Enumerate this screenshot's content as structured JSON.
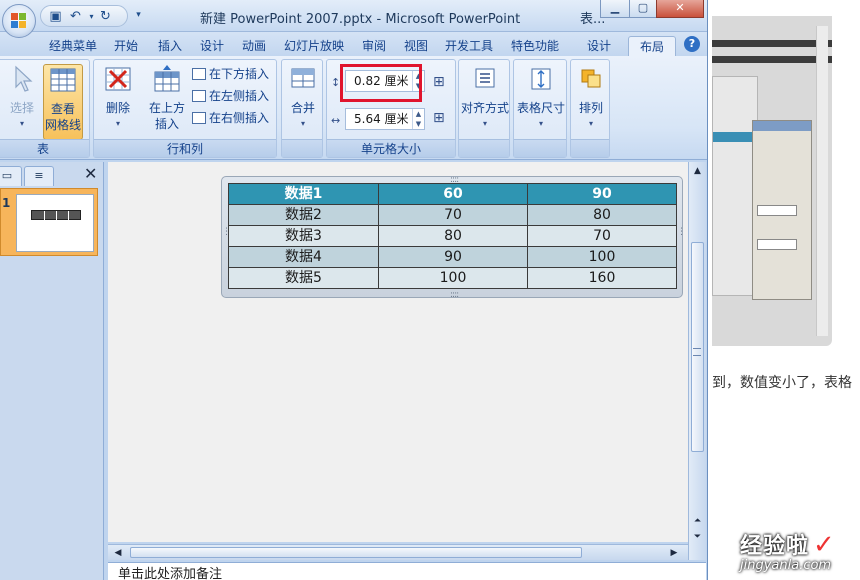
{
  "window": {
    "title": "新建 PowerPoint 2007.pptx - Microsoft PowerPoint",
    "title_extra": "表..."
  },
  "quick_access": {
    "save_icon": "save-icon",
    "undo_icon": "undo-icon",
    "redo_icon": "redo-icon",
    "customize_icon": "chevron-down-icon"
  },
  "tabs": [
    {
      "label": "经典菜单"
    },
    {
      "label": "开始"
    },
    {
      "label": "插入"
    },
    {
      "label": "设计"
    },
    {
      "label": "动画"
    },
    {
      "label": "幻灯片放映"
    },
    {
      "label": "审阅"
    },
    {
      "label": "视图"
    },
    {
      "label": "开发工具"
    },
    {
      "label": "特色功能"
    },
    {
      "label": "设计"
    },
    {
      "label": "布局"
    }
  ],
  "active_tab": "布局",
  "ribbon": {
    "table_group": {
      "label": "表",
      "select_label": "选择",
      "view_gridlines_label": "查看\n网格线"
    },
    "rows_cols_group": {
      "label": "行和列",
      "delete_label": "删除",
      "insert_above_label": "在上方\n插入",
      "insert_below_label": "在下方插入",
      "insert_left_label": "在左侧插入",
      "insert_right_label": "在右侧插入"
    },
    "merge_group": {
      "merge_label": "合并"
    },
    "cell_size_group": {
      "label": "单元格大小",
      "height_value": "0.82 厘米",
      "width_value": "5.64 厘米"
    },
    "alignment_label": "对齐方式",
    "table_size_label": "表格尺寸",
    "arrange_label": "排列"
  },
  "table": {
    "rows": [
      [
        "数据1",
        "60",
        "90"
      ],
      [
        "数据2",
        "70",
        "80"
      ],
      [
        "数据3",
        "80",
        "70"
      ],
      [
        "数据4",
        "90",
        "100"
      ],
      [
        "数据5",
        "100",
        "160"
      ]
    ]
  },
  "notes_placeholder": "单击此处添加备注",
  "web_page": {
    "text": "到，数值变小了，表格",
    "watermark": "经验啦",
    "watermark_sub": "jingyanla.com"
  },
  "colors": {
    "header_fill": "#2f95b2",
    "row_fill": "#bfd3dc",
    "row_alt_fill": "#dce7ec",
    "highlight": "#e0142d"
  }
}
